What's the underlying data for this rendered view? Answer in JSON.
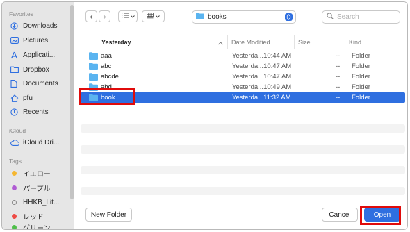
{
  "sidebar": {
    "sections": [
      {
        "title": "Favorites"
      },
      {
        "title": "iCloud"
      },
      {
        "title": "Tags"
      }
    ],
    "favorites": [
      {
        "label": "Downloads",
        "icon": "download-icon"
      },
      {
        "label": "Pictures",
        "icon": "pictures-icon"
      },
      {
        "label": "Applicati...",
        "icon": "applications-icon"
      },
      {
        "label": "Dropbox",
        "icon": "folder-icon"
      },
      {
        "label": "Documents",
        "icon": "document-icon"
      },
      {
        "label": "pfu",
        "icon": "home-icon"
      },
      {
        "label": "Recents",
        "icon": "clock-icon"
      }
    ],
    "icloud": [
      {
        "label": "iCloud Dri...",
        "icon": "cloud-icon"
      }
    ],
    "tags": [
      {
        "label": "イエロー",
        "color": "#f5b731"
      },
      {
        "label": "パープル",
        "color": "#b05cd3"
      },
      {
        "label": "HHKB_Lit...",
        "color": ""
      },
      {
        "label": "レッド",
        "color": "#ee4b45"
      },
      {
        "label": "グリーン",
        "color": "#4fbf4a"
      }
    ]
  },
  "toolbar": {
    "back": "‹",
    "forward": "›",
    "path_label": "books",
    "search_placeholder": "Search"
  },
  "columns": {
    "name": "Yesterday",
    "date": "Date Modified",
    "size": "Size",
    "kind": "Kind"
  },
  "rows": [
    {
      "name": "aaa",
      "date": "Yesterda...10:44 AM",
      "size": "--",
      "kind": "Folder",
      "selected": false
    },
    {
      "name": "abc",
      "date": "Yesterda...10:47 AM",
      "size": "--",
      "kind": "Folder",
      "selected": false
    },
    {
      "name": "abcde",
      "date": "Yesterda...10:47 AM",
      "size": "--",
      "kind": "Folder",
      "selected": false
    },
    {
      "name": "abd",
      "date": "Yesterda...10:49 AM",
      "size": "--",
      "kind": "Folder",
      "selected": false
    },
    {
      "name": "book",
      "date": "Yesterda...11:32 AM",
      "size": "--",
      "kind": "Folder",
      "selected": true
    }
  ],
  "buttons": {
    "new_folder": "New Folder",
    "cancel": "Cancel",
    "open": "Open"
  },
  "colors": {
    "accent": "#2f6fe0",
    "annotation": "#e00b0b",
    "folder": "#5ab4f0"
  }
}
